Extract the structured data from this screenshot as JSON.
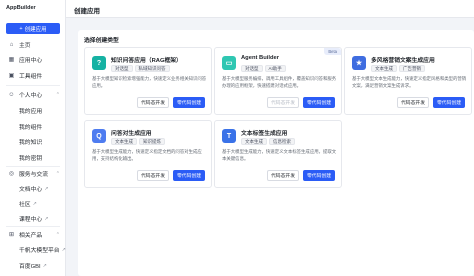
{
  "app": {
    "brand": "AppBuilder"
  },
  "sidebar": {
    "create_label": "创建应用",
    "items": [
      {
        "label": "主页",
        "icon": "home-icon"
      },
      {
        "label": "应用中心",
        "icon": "app-center-icon"
      },
      {
        "label": "工具组件",
        "icon": "tools-icon"
      },
      {
        "label": "个人中心",
        "icon": "user-icon"
      },
      {
        "label": "我的应用"
      },
      {
        "label": "我的组件"
      },
      {
        "label": "我的知识"
      },
      {
        "label": "我的密钥"
      },
      {
        "label": "服务与交流",
        "icon": "service-icon"
      },
      {
        "label": "文档中心"
      },
      {
        "label": "社区"
      },
      {
        "label": "课程中心"
      },
      {
        "label": "相关产品",
        "icon": "products-icon"
      },
      {
        "label": "千帆大模型平台"
      },
      {
        "label": "百度GBI"
      }
    ]
  },
  "header": {
    "title": "创建应用"
  },
  "main": {
    "section_title": "选择创建类型",
    "cards": [
      {
        "title": "知识问答应用（RAG框架）",
        "tags": [
          "对话型",
          "私域知识问答"
        ],
        "desc": "基于大模型知识检索增强能力，快速定义业务相关知识问答应用。",
        "secondary": "代码态开发",
        "primary": "零代码创建",
        "icon_color": "#16b2a3"
      },
      {
        "title": "Agent Builder",
        "badge": "Beta",
        "tags": [
          "对话型",
          "AI助手"
        ],
        "desc": "基于大模型服务编排，调用工具组件，覆盖知识问答和服务办理的应用框架，快速搭建对话式应用。",
        "secondary": "代码态开发",
        "primary": "零代码创建",
        "icon_color": "#2fc7b2"
      },
      {
        "title": "多风格营销文案生成应用",
        "tags": [
          "文本生成",
          "广告营销"
        ],
        "desc": "基于大模型文本生成能力，快速定义指定风格和类型的营销文案，满足营销文案生成诉求。",
        "secondary": "代码态开发",
        "primary": "零代码创建",
        "icon_color": "#3f6de0"
      },
      {
        "title": "问答对生成应用",
        "tags": [
          "文本生成",
          "知识提炼"
        ],
        "desc": "基于大模型生成能力，快速定义指定文档的问答对生成应用，支持结构化输出。",
        "secondary": "代码态开发",
        "primary": "零代码创建",
        "icon_color": "#4e7cf0"
      },
      {
        "title": "文本标签生成应用",
        "tags": [
          "文本生成",
          "信息检索"
        ],
        "desc": "基于大模型生成能力，快速定义文本标签生成应用，提取文本关键信息。",
        "secondary": "代码态开发",
        "primary": "零代码创建",
        "icon_color": "#3a72e8"
      }
    ]
  }
}
